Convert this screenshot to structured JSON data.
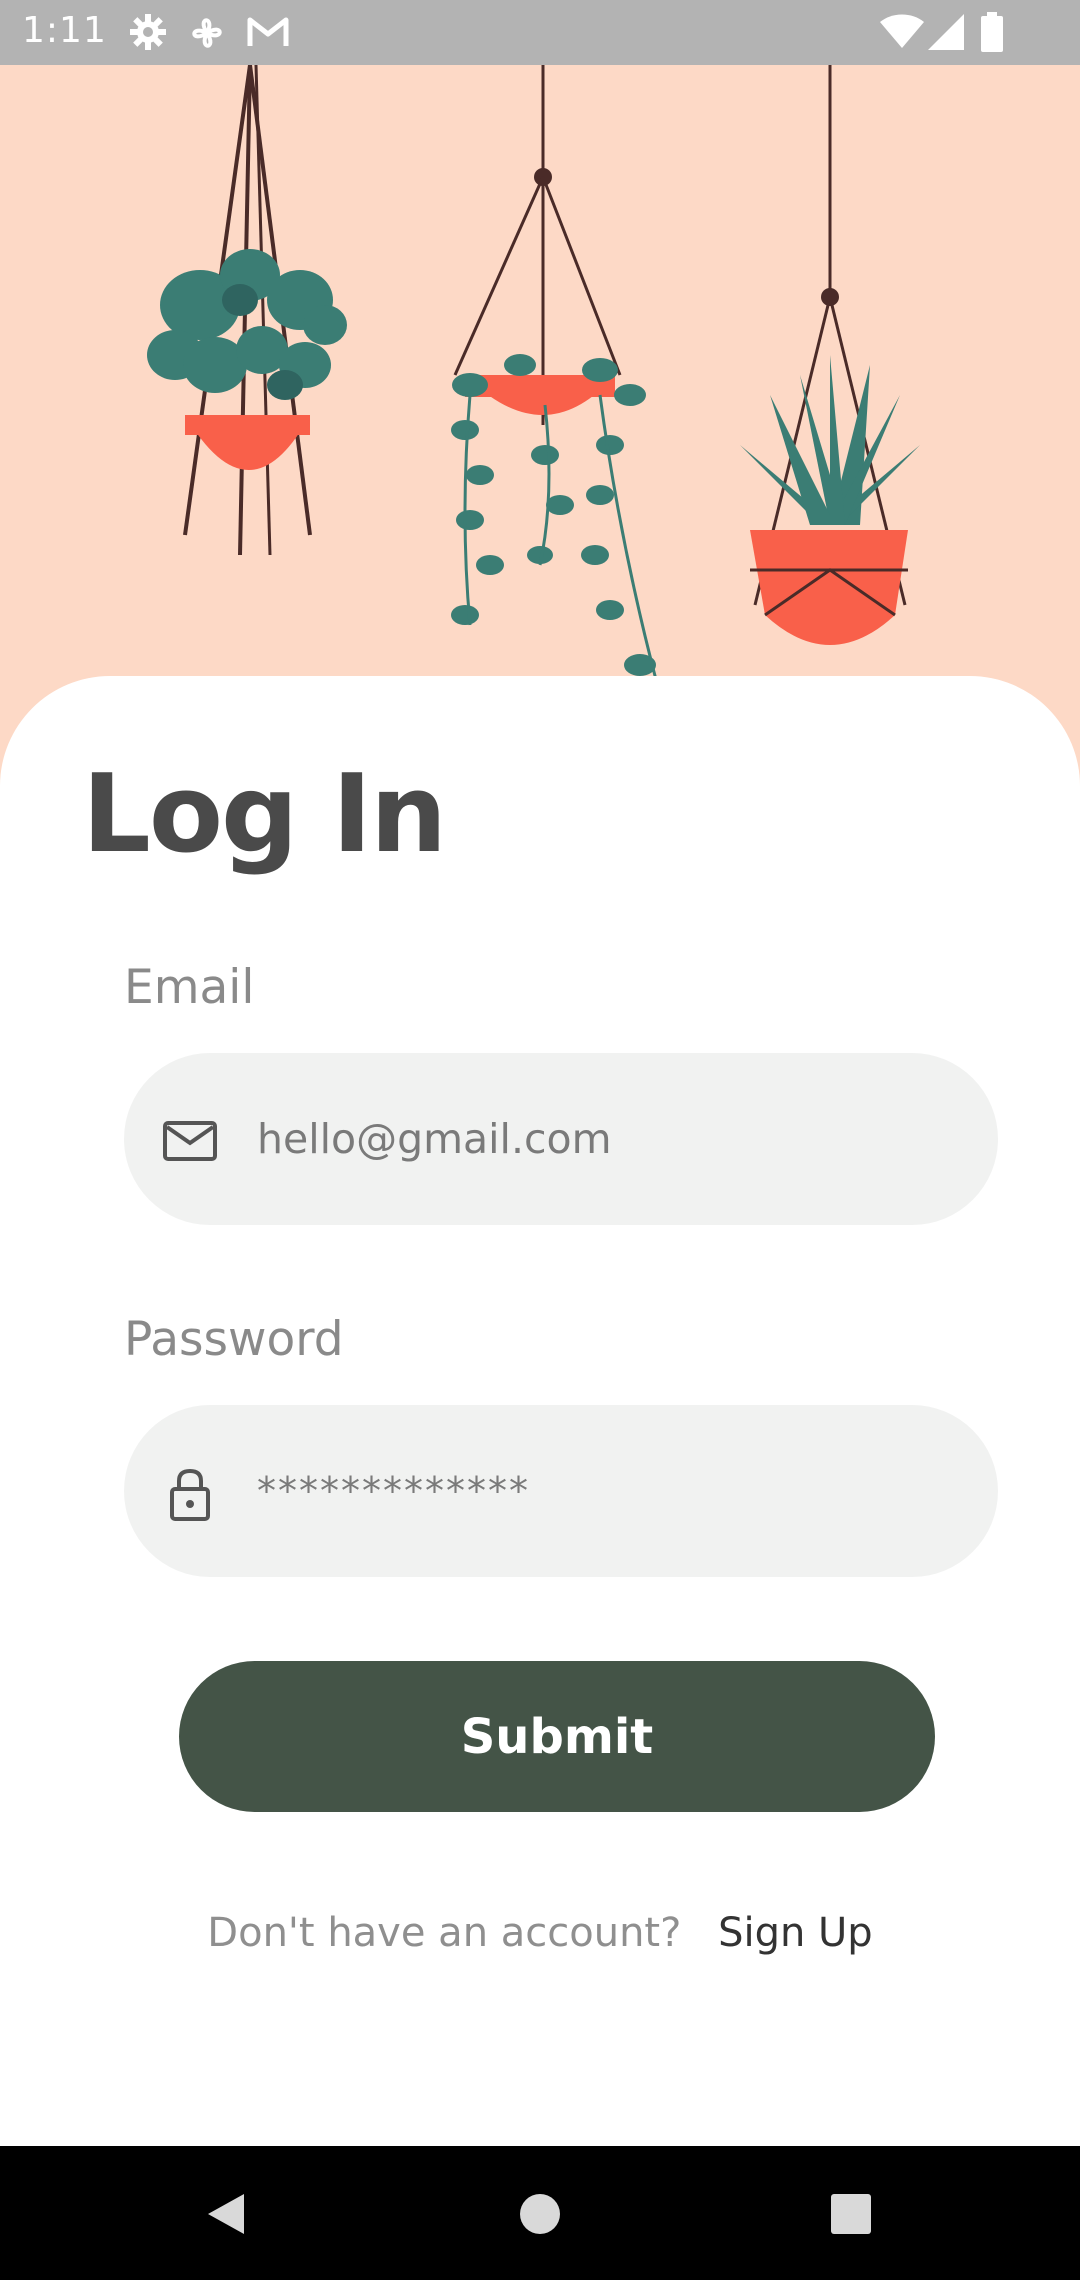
{
  "status_bar": {
    "time": "1:11",
    "icons": [
      "settings-icon",
      "pinwheel-icon",
      "gmail-icon",
      "wifi-icon",
      "signal-icon",
      "battery-icon"
    ]
  },
  "login": {
    "title": "Log In",
    "email_label": "Email",
    "email_placeholder": "hello@gmail.com",
    "password_label": "Password",
    "password_value": "*************",
    "submit_label": "Submit",
    "signup_prompt": "Don't have an account?",
    "signup_link": "Sign Up"
  },
  "colors": {
    "hero_background": "#fdd9c6",
    "submit_button": "#445447",
    "input_background": "#f1f2f1",
    "pot": "#f9604a",
    "leaves": "#3b7d74"
  },
  "nav_bar": {
    "buttons": [
      "back-icon",
      "home-icon",
      "recents-icon"
    ]
  }
}
